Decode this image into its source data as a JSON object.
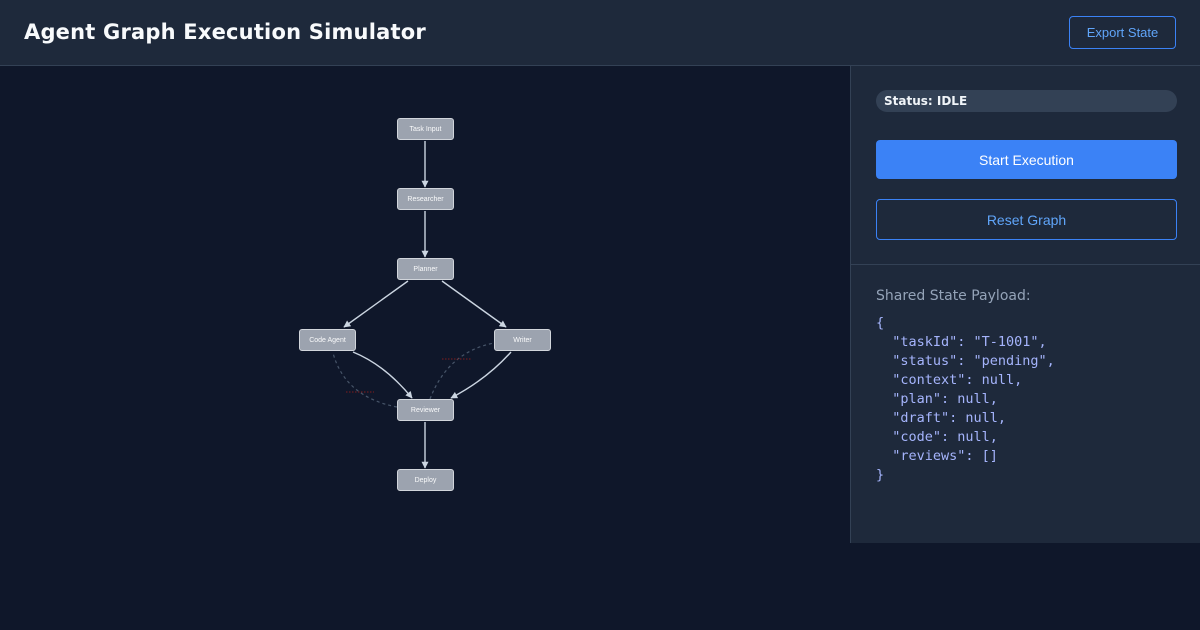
{
  "header": {
    "title": "Agent Graph Execution Simulator",
    "export_label": "Export State"
  },
  "graph": {
    "nodes": [
      {
        "id": "task_input",
        "label": "Task Input"
      },
      {
        "id": "researcher",
        "label": "Researcher"
      },
      {
        "id": "planner",
        "label": "Planner"
      },
      {
        "id": "code_agent",
        "label": "Code Agent"
      },
      {
        "id": "writer",
        "label": "Writer"
      },
      {
        "id": "reviewer",
        "label": "Reviewer"
      },
      {
        "id": "deploy",
        "label": "Deploy"
      }
    ],
    "edges": [
      {
        "from": "task_input",
        "to": "researcher",
        "style": "solid"
      },
      {
        "from": "researcher",
        "to": "planner",
        "style": "solid"
      },
      {
        "from": "planner",
        "to": "code_agent",
        "style": "solid"
      },
      {
        "from": "planner",
        "to": "writer",
        "style": "solid"
      },
      {
        "from": "code_agent",
        "to": "reviewer",
        "style": "solid"
      },
      {
        "from": "writer",
        "to": "reviewer",
        "style": "solid"
      },
      {
        "from": "reviewer",
        "to": "code_agent",
        "style": "dashed"
      },
      {
        "from": "reviewer",
        "to": "writer",
        "style": "dashed"
      },
      {
        "from": "reviewer",
        "to": "deploy",
        "style": "solid"
      }
    ],
    "colors": {
      "node_fill": "#9ca3af",
      "edge": "#cbd5e1",
      "feedback_edge": "#475569",
      "feedback_label": "#7f1d1d"
    }
  },
  "sidebar": {
    "status_text": "Status: IDLE",
    "start_label": "Start Execution",
    "reset_label": "Reset Graph",
    "payload_label": "Shared State Payload:",
    "payload_json": "{\n  \"taskId\": \"T-1001\",\n  \"status\": \"pending\",\n  \"context\": null,\n  \"plan\": null,\n  \"draft\": null,\n  \"code\": null,\n  \"reviews\": []\n}"
  },
  "theme": {
    "background": "#0f172a",
    "panel": "#1e293b",
    "accent": "#3b82f6"
  }
}
